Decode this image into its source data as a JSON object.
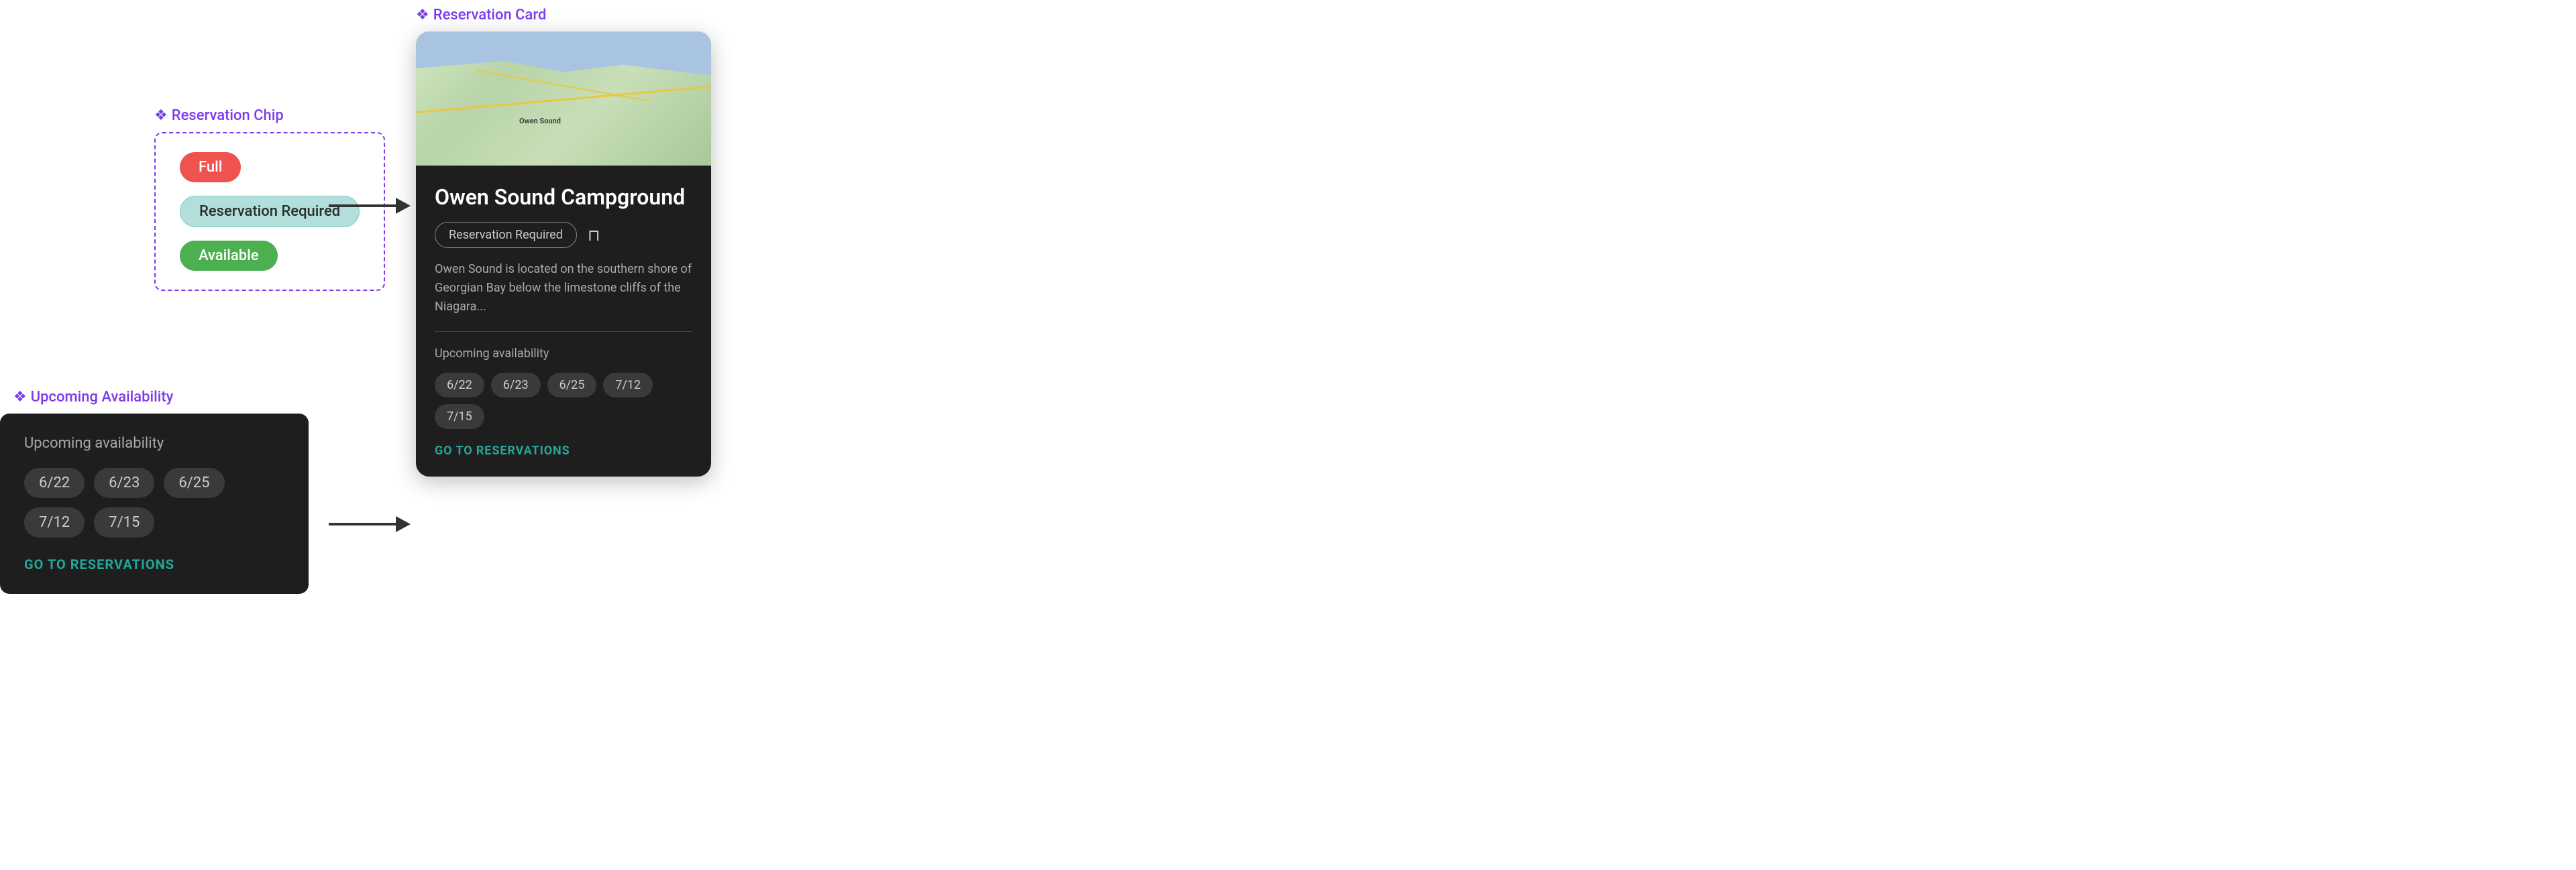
{
  "reservationChip": {
    "label": "Reservation Chip",
    "chips": {
      "full": "Full",
      "reservationRequired": "Reservation Required",
      "available": "Available"
    }
  },
  "upcomingAvailability": {
    "label": "Upcoming Availability",
    "title": "Upcoming availability",
    "dates": [
      "6/22",
      "6/23",
      "6/25",
      "7/12",
      "7/15"
    ],
    "goToReservations": "GO TO RESERVATIONS"
  },
  "reservationCard": {
    "label": "Reservation Card",
    "campgroundName": "Owen Sound Campground",
    "chipLabel": "Reservation Required",
    "description": "Owen Sound is located on the southern shore of Georgian Bay below the limestone cliffs of the Niagara...",
    "availabilityTitle": "Upcoming availability",
    "dates": [
      "6/22",
      "6/23",
      "6/25",
      "7/12",
      "7/15"
    ],
    "goToReservations": "GO TO RESERVATIONS"
  },
  "arrows": {
    "label1": "→",
    "label2": "→"
  },
  "icons": {
    "diamond": "❖",
    "bookmark": "⊓"
  }
}
